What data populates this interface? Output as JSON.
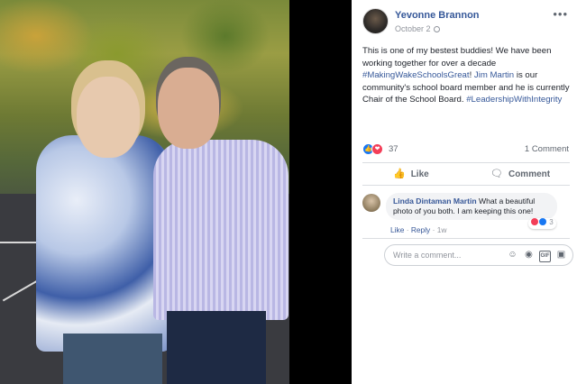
{
  "post": {
    "author": "Yevonne Brannon",
    "date": "October 2",
    "more_label": "•••",
    "text_1": "This is one of my bestest buddies! We have been working together for over a decade ",
    "tag_1": "#MakingWakeSchoolsGreat",
    "text_2": "! ",
    "tag_2": "Jim Martin",
    "text_3": " is our community's school board member and he is currently Chair of the School Board. ",
    "tag_3": "#LeadershipWithIntegrity"
  },
  "stats": {
    "reaction_count": "37",
    "comment_count": "1 Comment"
  },
  "actions": {
    "like_label": "Like",
    "comment_label": "Comment"
  },
  "comment": {
    "author": "Linda Dintaman Martin",
    "text": " What a beautiful photo of you both. I am keeping this one!",
    "reaction_count": "3",
    "like_label": "Like",
    "reply_label": "Reply",
    "separator": " · ",
    "time": "1w"
  },
  "composer": {
    "placeholder": "Write a comment...",
    "gif_label": "GIF"
  },
  "icons": {
    "like": "thumbs-up-icon",
    "comment": "speech-bubble-icon",
    "emoji": "smiley-icon",
    "camera": "camera-icon",
    "gif": "gif-icon",
    "sticker": "sticker-icon"
  },
  "colors": {
    "link": "#365899",
    "like": "#1877f2",
    "love": "#f33e58"
  }
}
